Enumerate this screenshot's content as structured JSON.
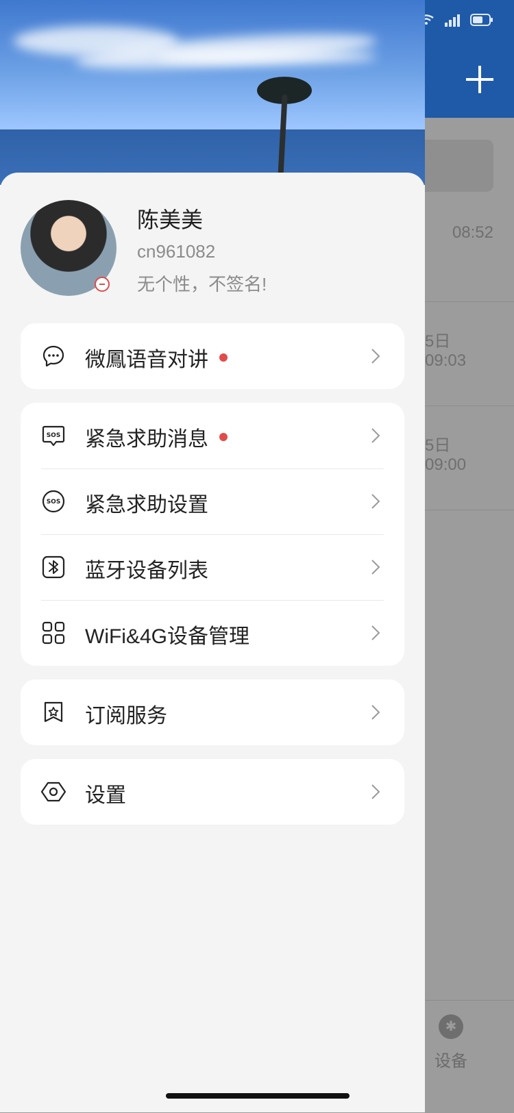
{
  "background_app": {
    "times": [
      "08:52",
      "5日 09:03",
      "5日 09:00"
    ],
    "tab_label": "设备"
  },
  "profile": {
    "name": "陈美美",
    "user_id": "cn961082",
    "signature": "无个性，不签名!"
  },
  "menu": {
    "voice": {
      "label": "微鳳语音对讲",
      "unread": true
    },
    "sos_messages": {
      "label": "紧急求助消息",
      "unread": true
    },
    "sos_settings": {
      "label": "紧急求助设置"
    },
    "bluetooth_list": {
      "label": "蓝牙设备列表"
    },
    "wifi_4g": {
      "label": "WiFi&4G设备管理"
    },
    "subscription": {
      "label": "订阅服务"
    },
    "settings": {
      "label": "设置"
    }
  },
  "icons": {
    "voice": "chat-bubble-icon",
    "sos_messages": "sos-message-icon",
    "sos_settings": "sos-circle-icon",
    "bluetooth_list": "bluetooth-icon",
    "wifi_4g": "grid-icon",
    "subscription": "badge-star-icon",
    "settings": "hexagon-settings-icon",
    "chevron": "chevron-right-icon"
  },
  "colors": {
    "accent": "#1f5aa8",
    "unread_dot": "#e24b4b"
  }
}
